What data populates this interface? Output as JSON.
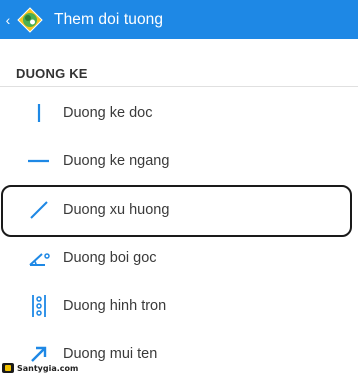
{
  "appbar": {
    "title": "Them doi tuong",
    "back_icon": "chevron-left-icon",
    "logo_icon": "app-logo-icon",
    "color": "#1e88e5"
  },
  "section": {
    "header": "DUONG KE",
    "items": [
      {
        "label": "Duong ke doc",
        "icon": "vertical-line-icon"
      },
      {
        "label": "Duong ke ngang",
        "icon": "horizontal-line-icon"
      },
      {
        "label": "Duong xu huong",
        "icon": "trend-line-icon",
        "selected": true
      },
      {
        "label": "Duong boi goc",
        "icon": "angle-icon"
      },
      {
        "label": "Duong hinh tron",
        "icon": "cycle-lines-icon"
      },
      {
        "label": "Duong mui ten",
        "icon": "arrow-icon"
      }
    ]
  },
  "accent_color": "#1e88e5",
  "watermark": {
    "text": "Santygia.com"
  }
}
